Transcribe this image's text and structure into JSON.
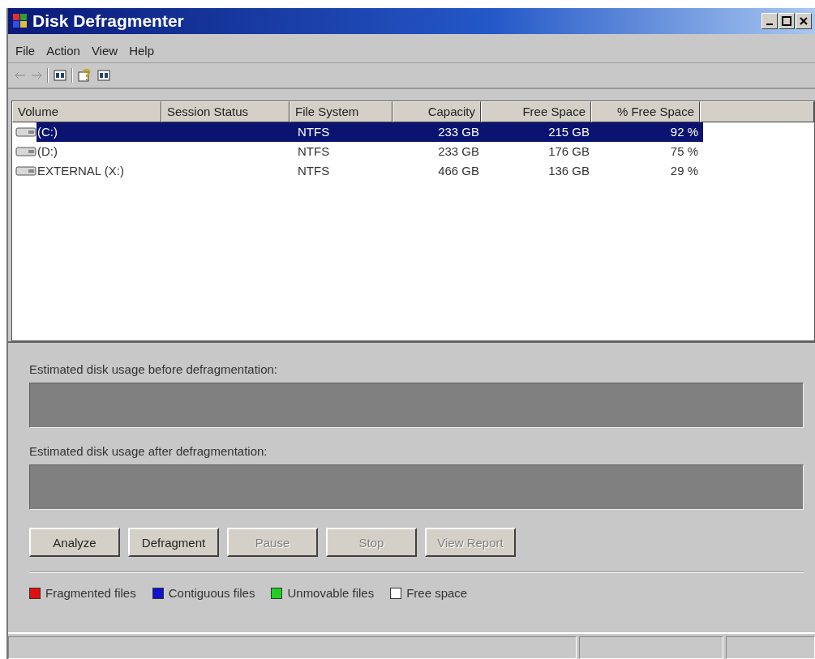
{
  "window": {
    "title": "Disk Defragmenter"
  },
  "menu": [
    "File",
    "Action",
    "View",
    "Help"
  ],
  "volumes": {
    "columns": [
      "Volume",
      "Session Status",
      "File System",
      "Capacity",
      "Free Space",
      "% Free Space"
    ],
    "rows": [
      {
        "volume": "(C:)",
        "file_system": "NTFS",
        "capacity": "233 GB",
        "free_space": "215 GB",
        "percent_free": "92 %",
        "selected": true
      },
      {
        "volume": "(D:)",
        "file_system": "NTFS",
        "capacity": "233 GB",
        "free_space": "176 GB",
        "percent_free": "75 %",
        "selected": false
      },
      {
        "volume": "EXTERNAL (X:)",
        "file_system": "NTFS",
        "capacity": "466 GB",
        "free_space": "136 GB",
        "percent_free": "29 %",
        "selected": false
      }
    ]
  },
  "usage_before": {
    "label": "Estimated disk usage before defragmentation:"
  },
  "usage_after": {
    "label": "Estimated disk usage after defragmentation:"
  },
  "buttons": [
    {
      "label": "Analyze",
      "disabled": false
    },
    {
      "label": "Defragment",
      "disabled": false
    },
    {
      "label": "Pause",
      "disabled": true
    },
    {
      "label": "Stop",
      "disabled": true
    },
    {
      "label": "View Report",
      "disabled": true
    }
  ],
  "legend": [
    {
      "label": "Fragmented files",
      "color": "#e01010"
    },
    {
      "label": "Contiguous files",
      "color": "#1010d0"
    },
    {
      "label": "Unmovable files",
      "color": "#20d020"
    },
    {
      "label": "Free space",
      "color": "#ffffff"
    }
  ]
}
